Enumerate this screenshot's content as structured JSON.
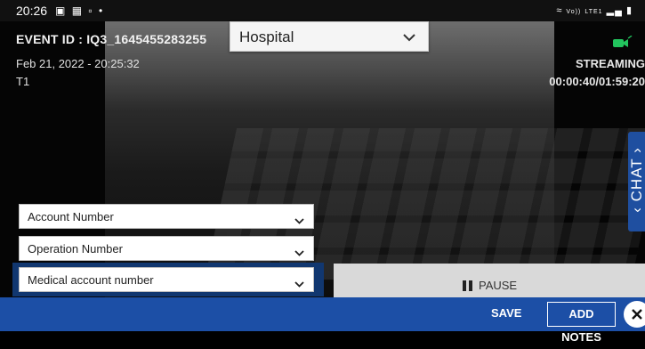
{
  "status_bar": {
    "time": "20:26",
    "left_icons": [
      "image-icon",
      "grid-icon",
      "app-icon",
      "dot-icon"
    ],
    "right_icons": [
      "wifi-icon",
      "volte-icon",
      "signal-icon",
      "battery-icon"
    ],
    "volte_text": "Vo))",
    "lte_text": "LTE1"
  },
  "event": {
    "id": "EVENT ID : IQ3_1645455283255",
    "datetime": "Feb 21, 2022 - 20:25:32",
    "tag": "T1"
  },
  "facility_select": {
    "value": "Hospital"
  },
  "stream": {
    "status": "STREAMING",
    "timer": "00:00:40/01:59:20",
    "camera_icon": "video-camera-icon"
  },
  "chat": {
    "label": "CHAT",
    "icons": [
      "chevron-up-icon",
      "chevron-down-icon"
    ]
  },
  "dropdowns": {
    "account": "Account Number",
    "operation": "Operation Number",
    "medical": "Medical account number"
  },
  "pause": {
    "label": "PAUSE",
    "icon": "pause-icon"
  },
  "bottom_bar": {
    "save_label": "SAVE",
    "notes_label": "ADD NOTES",
    "close_icon": "close-icon"
  },
  "colors": {
    "primary_blue": "#1c4fa6",
    "chat_blue": "#1f4fa0",
    "camera_green": "#22c55e",
    "pause_bg": "#d9d9d9"
  }
}
